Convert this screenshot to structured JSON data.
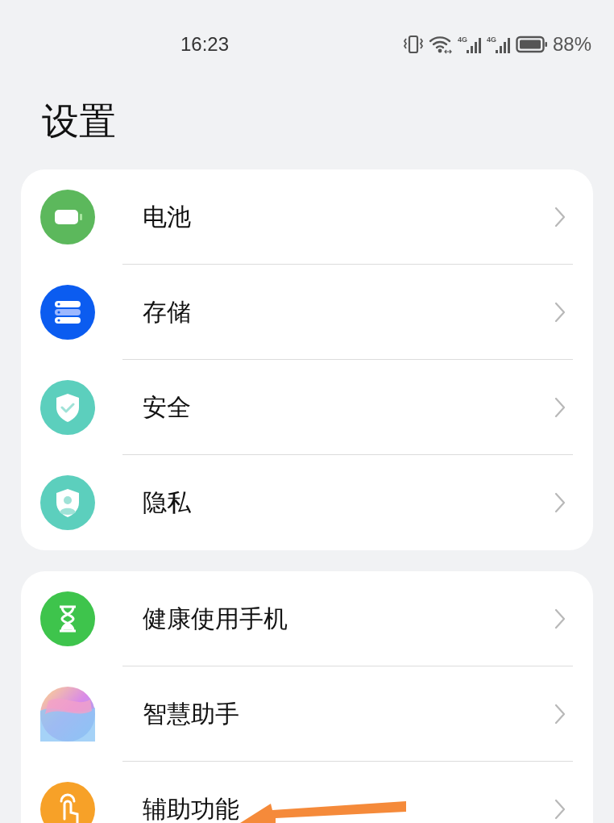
{
  "status_bar": {
    "time": "16:23",
    "signals": [
      {
        "label": "4G"
      },
      {
        "label": "4G"
      }
    ],
    "battery": "88%"
  },
  "title": "设置",
  "groups": [
    {
      "items": [
        {
          "label": "电池",
          "kind": "battery"
        },
        {
          "label": "存储",
          "kind": "storage"
        },
        {
          "label": "安全",
          "kind": "security"
        },
        {
          "label": "隐私",
          "kind": "privacy"
        }
      ]
    },
    {
      "items": [
        {
          "label": "健康使用手机",
          "kind": "hourglass"
        },
        {
          "label": "智慧助手",
          "kind": "assistant"
        },
        {
          "label": "辅助功能",
          "kind": "accessibility"
        }
      ]
    }
  ]
}
